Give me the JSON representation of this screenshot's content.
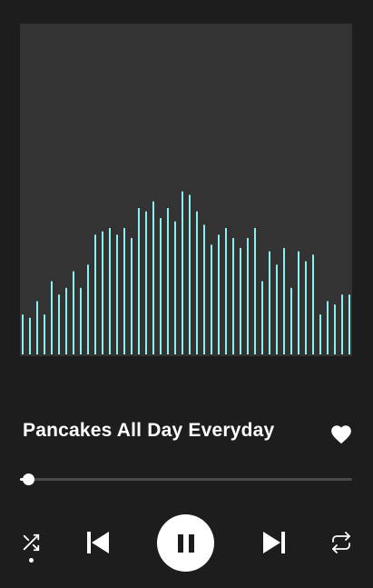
{
  "player": {
    "track_title": "Pancakes All Day Everyday",
    "liked": true,
    "progress": 0.02,
    "shuffle_active": true,
    "is_playing": true
  },
  "icons": {
    "like": "heart-icon",
    "shuffle": "shuffle-icon",
    "previous": "skip-previous-icon",
    "play_pause": "pause-icon",
    "next": "skip-next-icon",
    "repeat": "repeat-icon"
  },
  "colors": {
    "background": "#1d1d1d",
    "artwork_background": "#333333",
    "waveform": "#8ff0f0",
    "progress_track": "#4a4a4a",
    "foreground": "#ffffff"
  },
  "waveform_levels": [
    0.12,
    0.11,
    0.16,
    0.12,
    0.22,
    0.18,
    0.2,
    0.25,
    0.2,
    0.27,
    0.36,
    0.37,
    0.38,
    0.36,
    0.38,
    0.35,
    0.44,
    0.43,
    0.46,
    0.41,
    0.44,
    0.4,
    0.49,
    0.48,
    0.43,
    0.39,
    0.33,
    0.36,
    0.38,
    0.35,
    0.32,
    0.35,
    0.38,
    0.22,
    0.31,
    0.27,
    0.32,
    0.2,
    0.31,
    0.28,
    0.3,
    0.12,
    0.16,
    0.15,
    0.18,
    0.18
  ]
}
